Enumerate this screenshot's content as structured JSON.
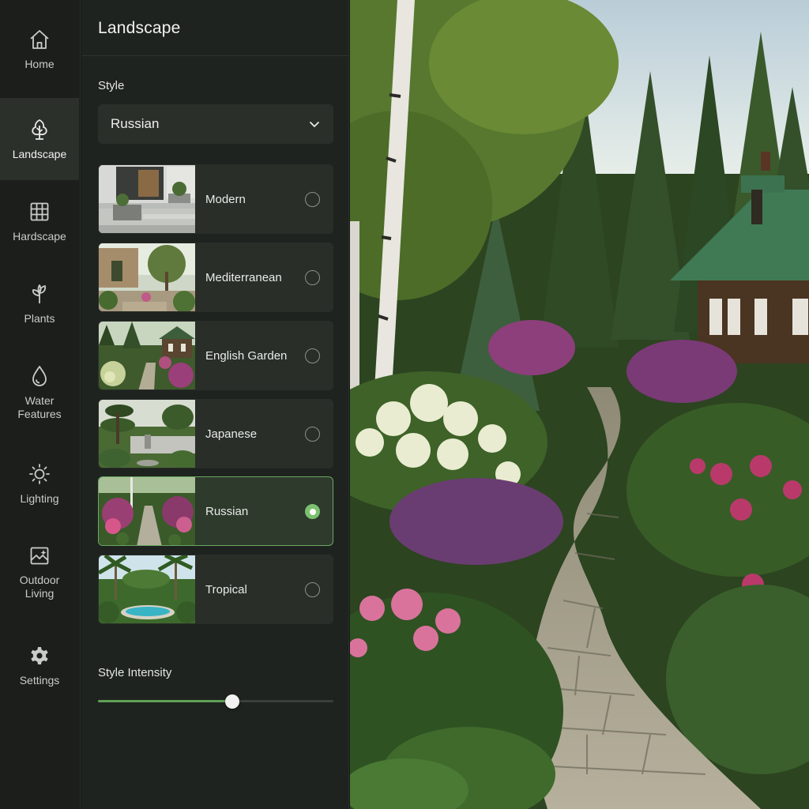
{
  "nav": {
    "items": [
      {
        "label": "Home",
        "icon": "home-icon",
        "active": false
      },
      {
        "label": "Landscape",
        "icon": "tree-icon",
        "active": true
      },
      {
        "label": "Hardscape",
        "icon": "grid-icon",
        "active": false
      },
      {
        "label": "Plants",
        "icon": "sprout-icon",
        "active": false
      },
      {
        "label": "Water\nFeatures",
        "icon": "water-drop-icon",
        "active": false
      },
      {
        "label": "Lighting",
        "icon": "sun-icon",
        "active": false
      },
      {
        "label": "Outdoor\nLiving",
        "icon": "image-sparkle-icon",
        "active": false
      },
      {
        "label": "Settings",
        "icon": "gear-icon",
        "active": false
      }
    ]
  },
  "panel": {
    "title": "Landscape",
    "style_label": "Style",
    "style_select_value": "Russian",
    "styles": [
      {
        "label": "Modern",
        "selected": false
      },
      {
        "label": "Mediterranean",
        "selected": false
      },
      {
        "label": "English Garden",
        "selected": false
      },
      {
        "label": "Japanese",
        "selected": false
      },
      {
        "label": "Russian",
        "selected": true
      },
      {
        "label": "Tropical",
        "selected": false
      }
    ],
    "intensity_label": "Style Intensity",
    "intensity_value": 0.57
  },
  "colors": {
    "accent": "#7cc070",
    "rail_bg": "#1b1e1b",
    "panel_bg": "#1f231f",
    "card_bg": "#292e29"
  }
}
